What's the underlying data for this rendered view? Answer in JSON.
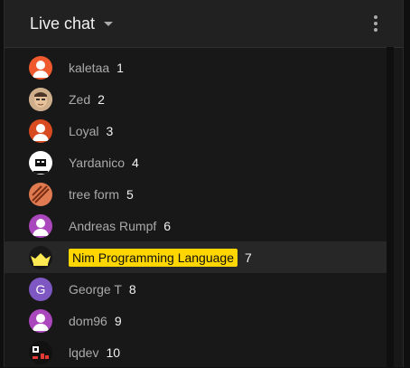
{
  "header": {
    "title": "Live chat"
  },
  "leaderboard": [
    {
      "name": "kaletaa",
      "rank": "1",
      "avatar": "kaletaa-avatar",
      "color": "#ef5b2e"
    },
    {
      "name": "Zed",
      "rank": "2",
      "avatar": "zed-avatar",
      "color": "#c98b61"
    },
    {
      "name": "Loyal",
      "rank": "3",
      "avatar": "loyal-avatar",
      "color": "#d84b20"
    },
    {
      "name": "Yardanico",
      "rank": "4",
      "avatar": "yardanico-avatar",
      "color": "#ffffff"
    },
    {
      "name": "tree form",
      "rank": "5",
      "avatar": "tree-form-avatar",
      "color": "#e07a50"
    },
    {
      "name": "Andreas Rumpf",
      "rank": "6",
      "avatar": "andreas-rumpf-avatar",
      "color": "#ab47bc"
    },
    {
      "name": "Nim Programming Language",
      "rank": "7",
      "avatar": "nim-crown-avatar",
      "color": "#ffe953",
      "owner": true
    },
    {
      "name": "George T",
      "rank": "8",
      "avatar": "george-t-avatar",
      "color": "#7e57c2",
      "initial": "G"
    },
    {
      "name": "dom96",
      "rank": "9",
      "avatar": "dom96-avatar",
      "color": "#ab47bc"
    },
    {
      "name": "lqdev",
      "rank": "10",
      "avatar": "lqdev-avatar",
      "color": "#e53935"
    }
  ],
  "colors": {
    "background": "#0f0f0f",
    "panel": "#181818",
    "header": "#212121",
    "owner_badge": "#ffd600"
  }
}
